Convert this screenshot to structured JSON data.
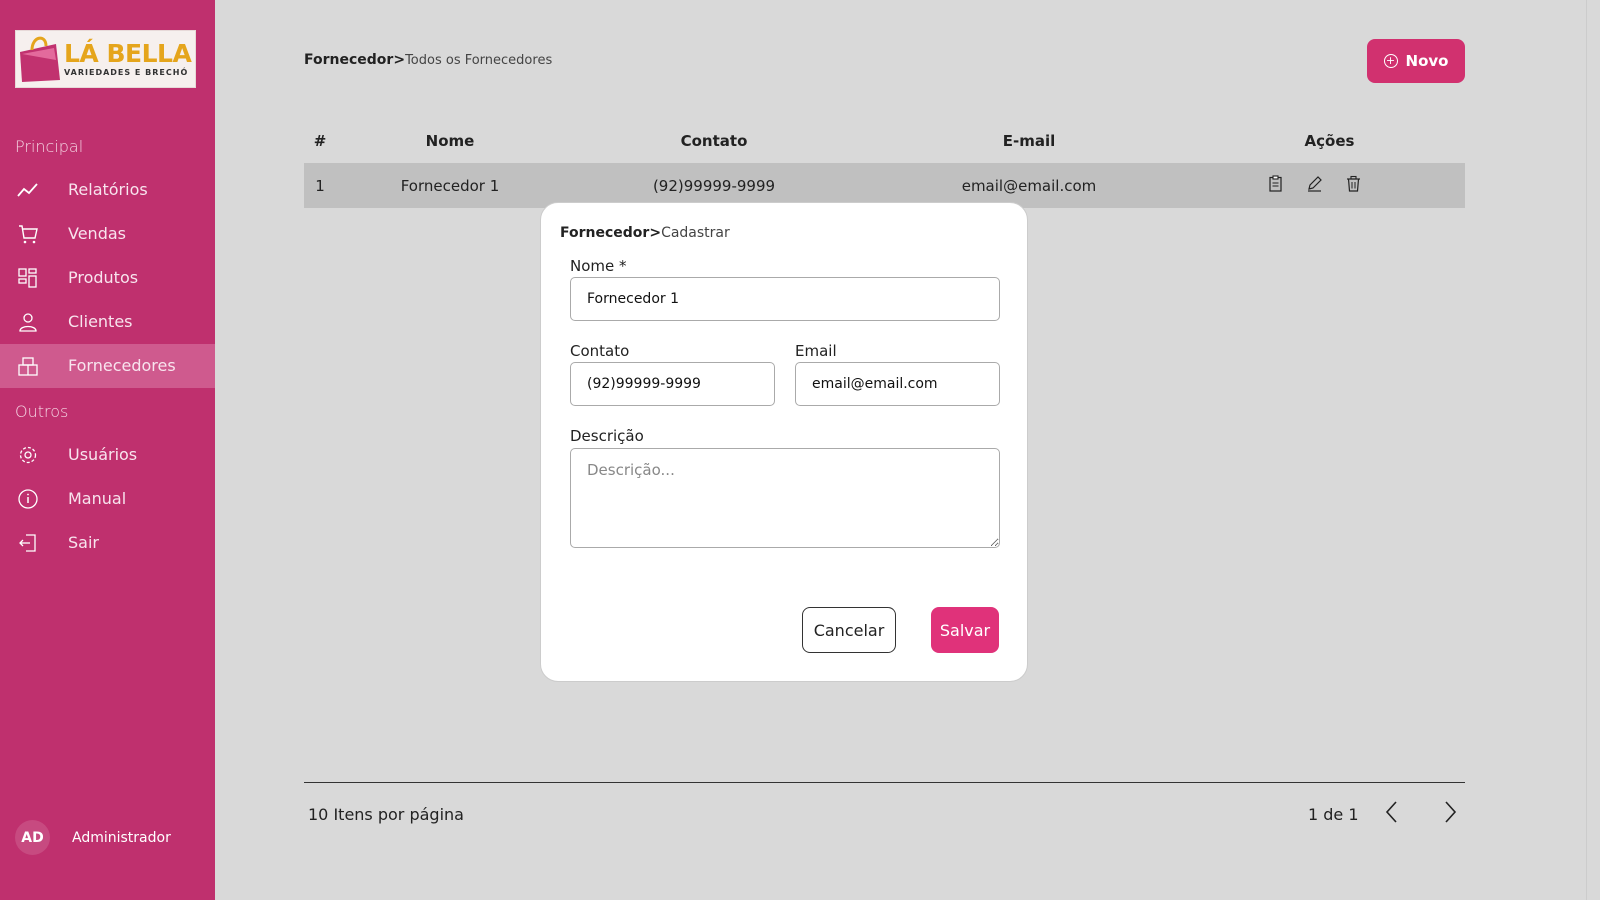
{
  "brand": {
    "name": "LÁ BELLA",
    "tagline": "VARIEDADES E BRECHÓ",
    "colors": {
      "sidebar": "#bf306e",
      "accent": "#d1316f",
      "logo_gold": "#e5a51c"
    }
  },
  "sidebar": {
    "section_main": "Principal",
    "section_other": "Outros",
    "items": [
      {
        "label": "Relatórios",
        "icon": "chart-line-icon"
      },
      {
        "label": "Vendas",
        "icon": "cart-icon"
      },
      {
        "label": "Produtos",
        "icon": "grid-icon"
      },
      {
        "label": "Clientes",
        "icon": "person-icon"
      },
      {
        "label": "Fornecedores",
        "icon": "store-icon",
        "active": true
      }
    ],
    "other_items": [
      {
        "label": "Usuários",
        "icon": "gear-icon"
      },
      {
        "label": "Manual",
        "icon": "info-icon"
      },
      {
        "label": "Sair",
        "icon": "logout-icon"
      }
    ],
    "user": {
      "initials": "AD",
      "name": "Administrador"
    }
  },
  "header": {
    "breadcrumb_strong": "Fornecedor",
    "breadcrumb_sep": ">",
    "breadcrumb_light": "Todos os Fornecedores",
    "new_button": "Novo"
  },
  "table": {
    "columns": [
      "#",
      "Nome",
      "Contato",
      "E-mail",
      "Ações"
    ],
    "rows": [
      {
        "idx": "1",
        "nome": "Fornecedor 1",
        "contato": "(92)99999-9999",
        "email": "email@email.com"
      }
    ]
  },
  "pagination": {
    "per_page": "10 Itens por página",
    "page_info": "1 de 1"
  },
  "modal": {
    "breadcrumb_strong": "Fornecedor",
    "breadcrumb_sep": ">",
    "breadcrumb_light": "Cadastrar",
    "nome_label": "Nome *",
    "nome_value": "Fornecedor 1",
    "contato_label": "Contato",
    "contato_value": "(92)99999-9999",
    "email_label": "Email",
    "email_value": "email@email.com",
    "descricao_label": "Descrição",
    "descricao_placeholder": "Descrição...",
    "cancel_label": "Cancelar",
    "save_label": "Salvar"
  }
}
